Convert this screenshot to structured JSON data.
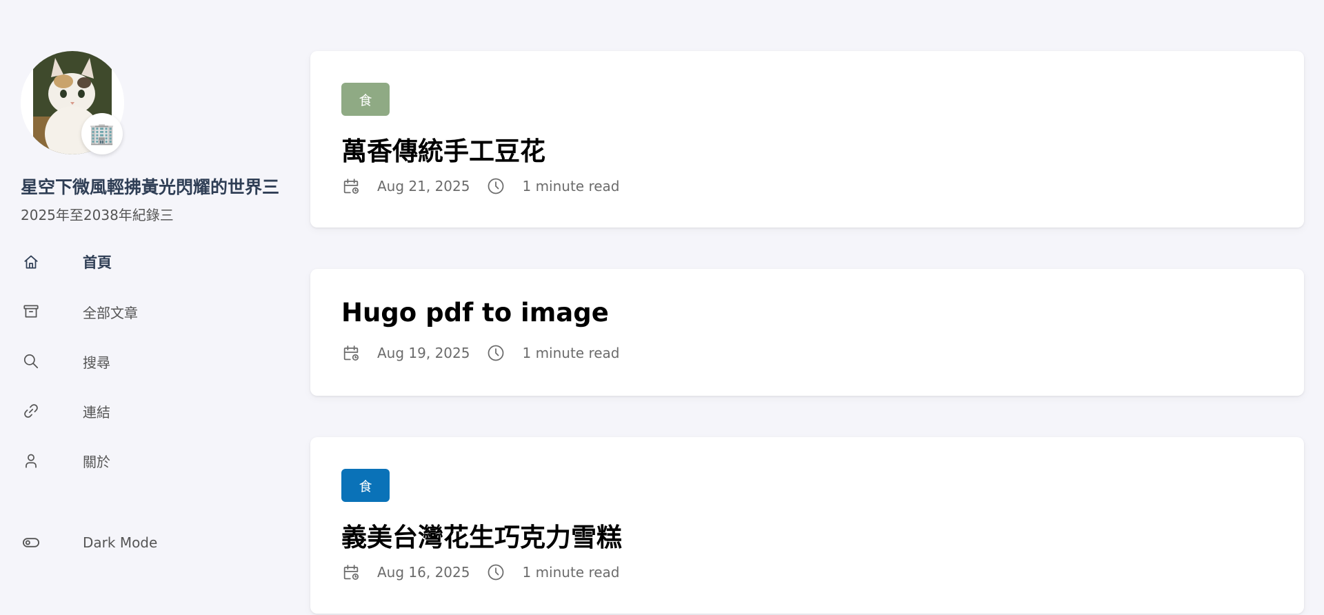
{
  "site": {
    "name": "星空下微風輕拂黃光閃耀的世界三",
    "description": "2025年至2038年紀錄三",
    "emoji": "🏢"
  },
  "menu": [
    {
      "label": "首頁",
      "icon": "home-icon",
      "active": true
    },
    {
      "label": "全部文章",
      "icon": "archive-icon",
      "active": false
    },
    {
      "label": "搜尋",
      "icon": "search-icon",
      "active": false
    },
    {
      "label": "連結",
      "icon": "link-icon",
      "active": false
    },
    {
      "label": "關於",
      "icon": "user-icon",
      "active": false
    }
  ],
  "dark_mode": {
    "label": "Dark Mode",
    "icon": "toggle-icon"
  },
  "posts": [
    {
      "category": "食",
      "category_color": "#8faa84",
      "title": "萬香傳統手工豆花",
      "date": "Aug 21, 2025",
      "read_time": "1 minute read"
    },
    {
      "category": "",
      "title": "Hugo pdf to image",
      "date": "Aug 19, 2025",
      "read_time": "1 minute read"
    },
    {
      "category": "食",
      "category_color": "#0a72b8",
      "title": "義美台灣花生巧克力雪糕",
      "date": "Aug 16, 2025",
      "read_time": "1 minute read"
    }
  ],
  "colors": {
    "background": "#f5f5fa",
    "accent_green": "#8faa84",
    "accent_blue": "#0a72b8",
    "heading": "#2f3e55"
  }
}
